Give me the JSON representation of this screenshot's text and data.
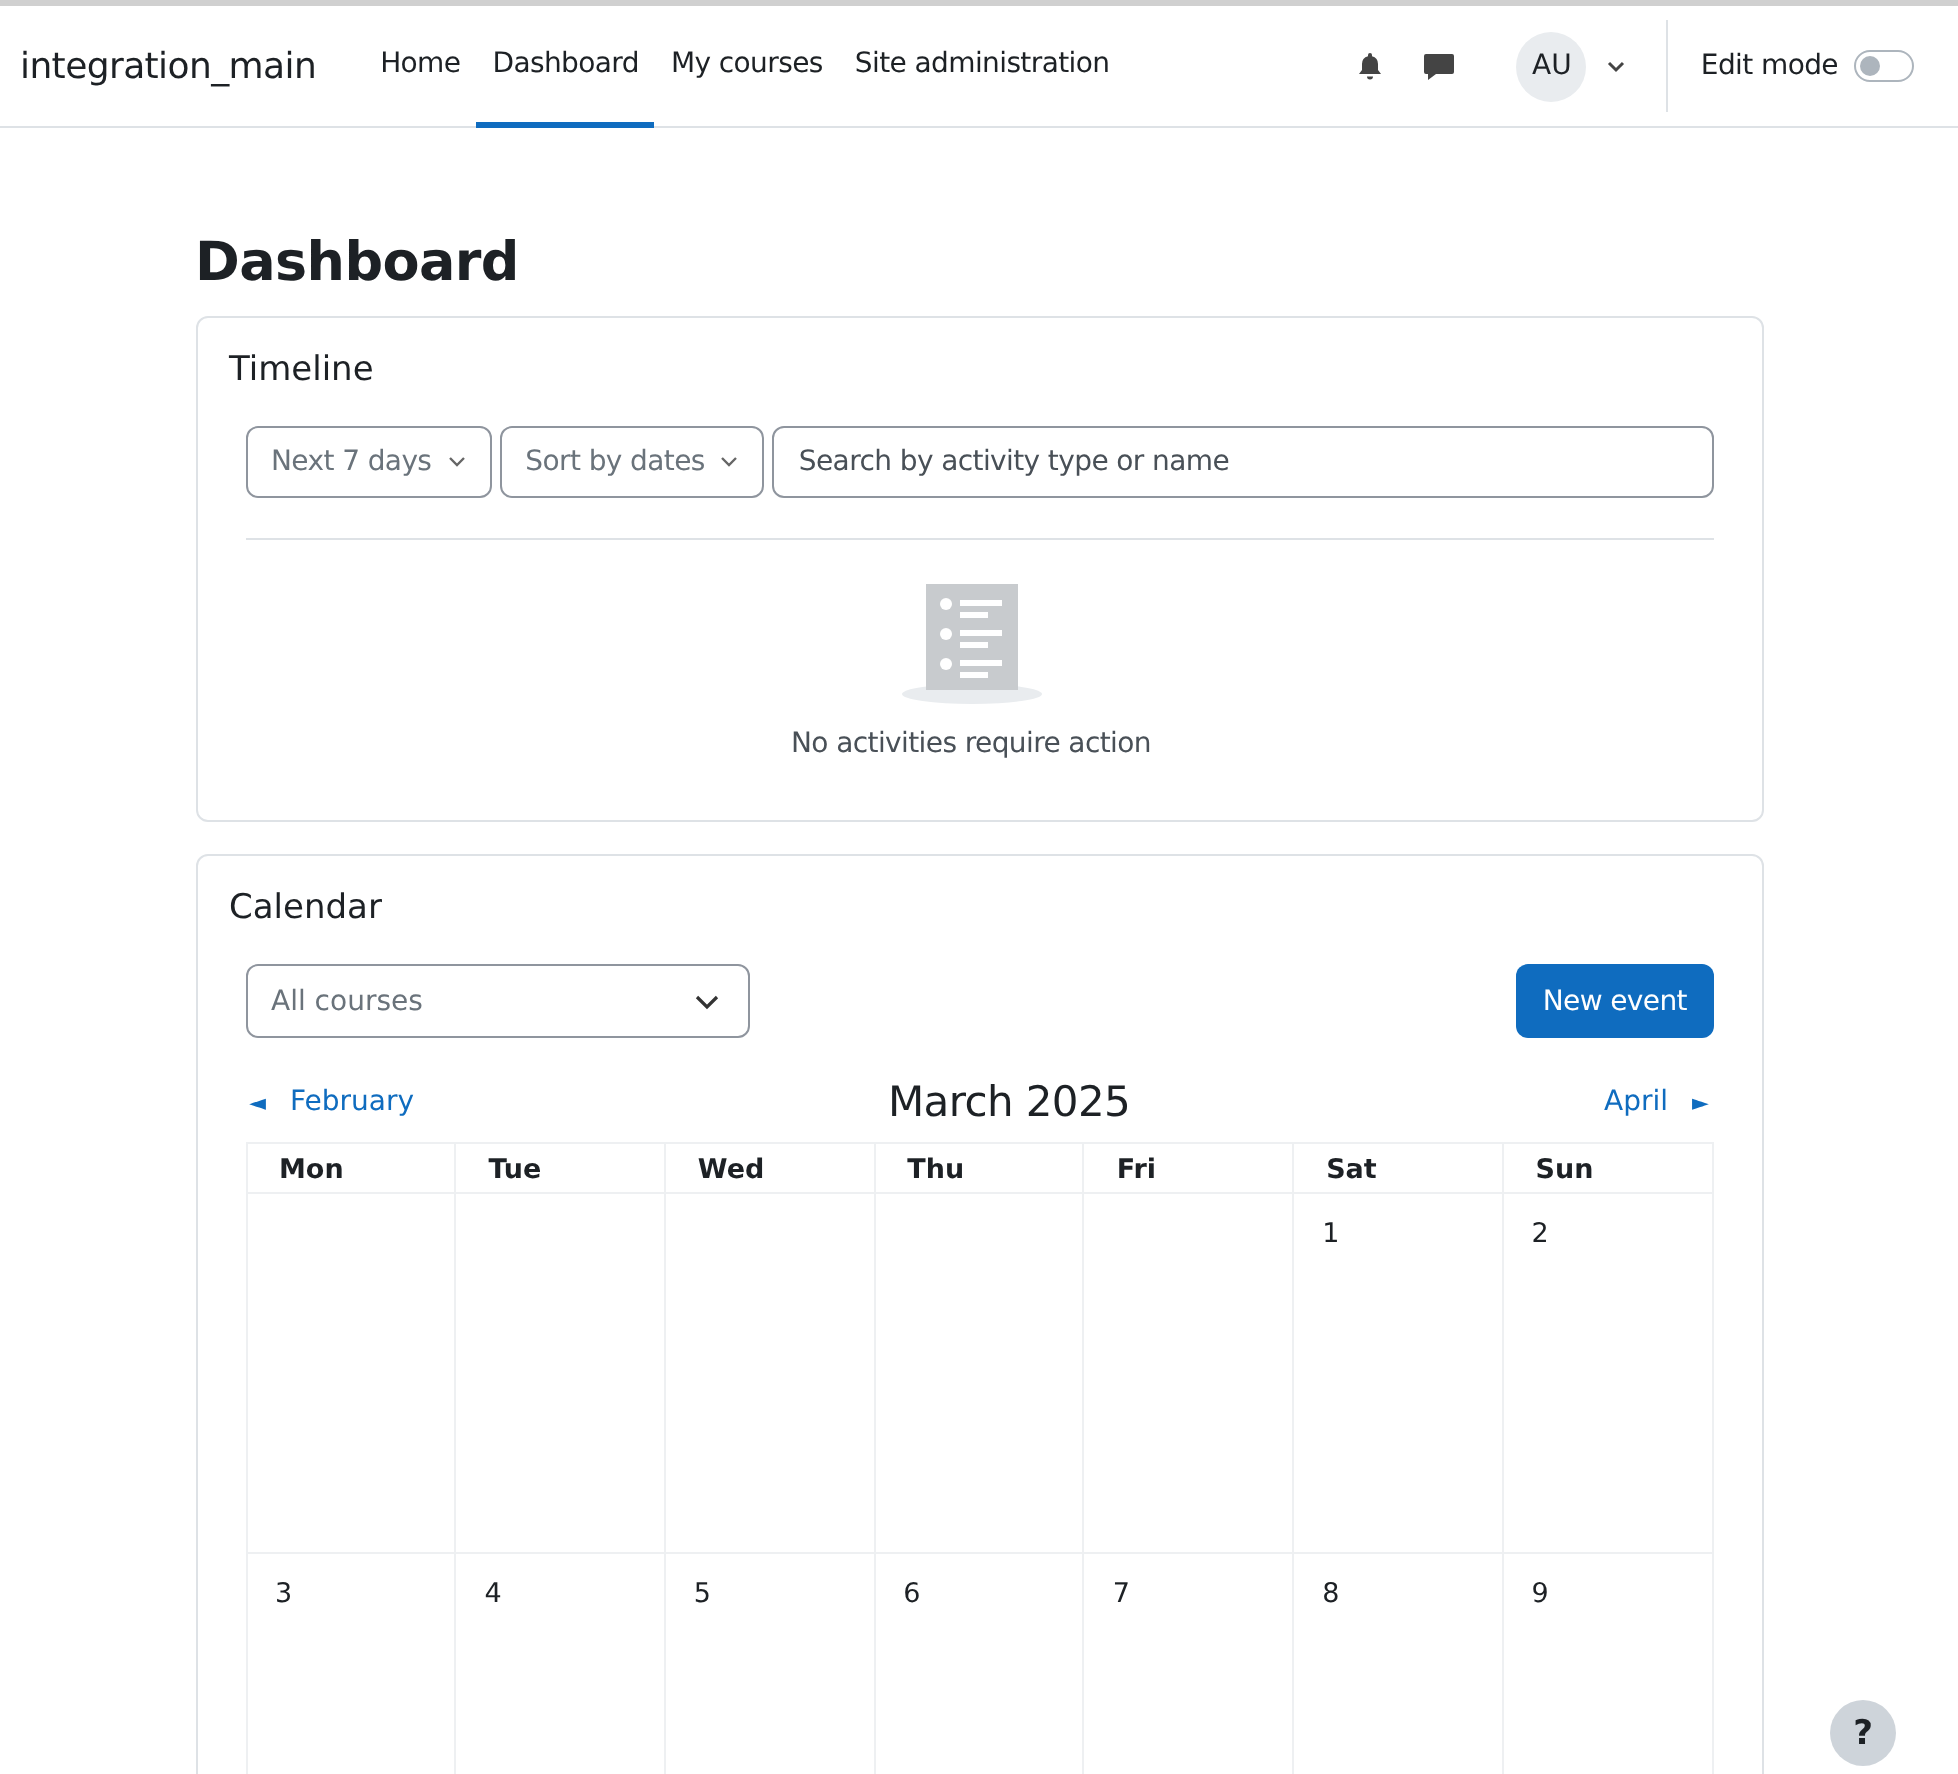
{
  "navbar": {
    "site_name": "integration_main",
    "links": [
      {
        "label": "Home",
        "selected": false
      },
      {
        "label": "Dashboard",
        "selected": true
      },
      {
        "label": "My courses",
        "selected": false
      },
      {
        "label": "Site administration",
        "selected": false
      }
    ],
    "avatar": "AU",
    "edit_mode": {
      "label": "Edit mode",
      "on": false
    }
  },
  "page_title": "Dashboard",
  "timeline": {
    "title": "Timeline",
    "filters": [
      "Next 7 days",
      "Sort by dates"
    ],
    "search": {
      "placeholder": "Search by activity type or name"
    },
    "empty_message": "No activities require action"
  },
  "calendar": {
    "title": "Calendar",
    "course_select": "All courses",
    "new_event": "New event",
    "prev": {
      "arrow": "◄",
      "label": "February"
    },
    "month": "March 2025",
    "next": {
      "arrow": "►",
      "label": "April"
    },
    "weekdays": [
      "Mon",
      "Tue",
      "Wed",
      "Thu",
      "Fri",
      "Sat",
      "Sun"
    ],
    "weeks": [
      [
        {
          "kind": "blank"
        },
        {
          "kind": "blank"
        },
        {
          "kind": "blank"
        },
        {
          "kind": "blank"
        },
        {
          "kind": "blank"
        },
        {
          "kind": "day",
          "day": "1"
        },
        {
          "kind": "day",
          "day": "2"
        }
      ],
      [
        {
          "kind": "day",
          "day": "3"
        },
        {
          "kind": "day",
          "day": "4"
        },
        {
          "kind": "day",
          "day": "5"
        },
        {
          "kind": "day",
          "day": "6"
        },
        {
          "kind": "day",
          "day": "7"
        },
        {
          "kind": "day",
          "day": "8"
        },
        {
          "kind": "day",
          "day": "9"
        }
      ]
    ]
  },
  "help_button": "?"
}
